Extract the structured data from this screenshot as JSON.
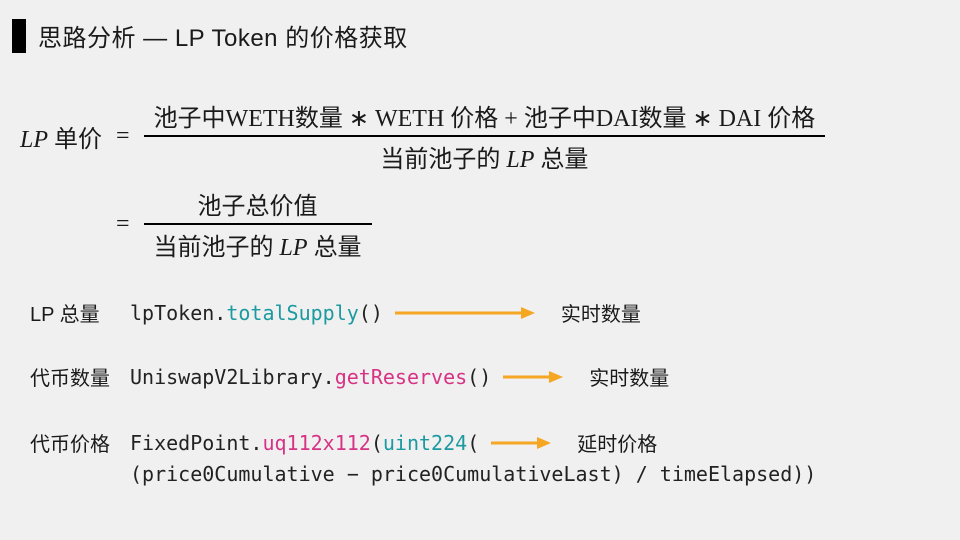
{
  "title": "思路分析 — LP Token 的价格获取",
  "formula1": {
    "lhs_italic": "LP",
    "lhs_unit": "单价",
    "num": "池子中WETH数量 ∗ WETH 价格 + 池子中DAI数量 ∗ DAI 价格",
    "den_prefix": "当前池子的 ",
    "den_italic": "LP",
    "den_suffix": " 总量"
  },
  "formula2": {
    "num": "池子总价值",
    "den_prefix": "当前池子的 ",
    "den_italic": "LP",
    "den_suffix": " 总量"
  },
  "rows": {
    "r1": {
      "label": "LP 总量",
      "code_obj": "lpToken",
      "code_dot": ".",
      "code_method": "totalSupply",
      "code_tail": "()",
      "result": "实时数量"
    },
    "r2": {
      "label": "代币数量",
      "code_obj": "UniswapV2Library",
      "code_dot": ".",
      "code_method": "getReserves",
      "code_tail": "()",
      "result": "实时数量"
    },
    "r3": {
      "label": "代币价格",
      "code_obj": "FixedPoint",
      "code_dot": ".",
      "code_method": "uq112x112",
      "code_open": "(",
      "code_type": "uint224",
      "code_after": "(",
      "result": "延时价格",
      "line2": "(price0Cumulative − price0CumulativeLast) / timeElapsed))"
    }
  }
}
